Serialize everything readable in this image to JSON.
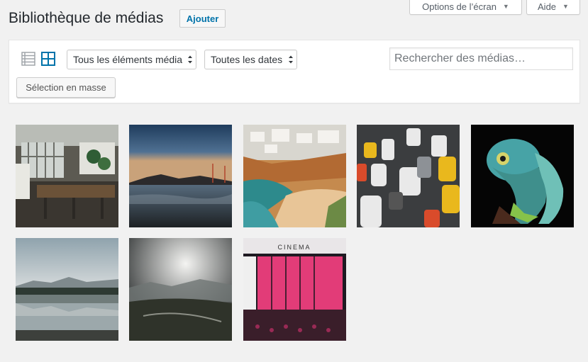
{
  "screen_meta": {
    "options_label": "Options de l’écran",
    "help_label": "Aide"
  },
  "header": {
    "title": "Bibliothèque de médias",
    "add_new_label": "Ajouter"
  },
  "toolbar": {
    "view_modes": [
      "list-view-icon",
      "grid-view-icon"
    ],
    "active_view": "grid",
    "type_filter_value": "Tous les éléments média",
    "date_filter_value": "Toutes les dates",
    "search_placeholder": "Rechercher des médias…",
    "bulk_select_label": "Sélection en masse"
  },
  "media_items": [
    {
      "subject": "workshop-interior"
    },
    {
      "subject": "bay-bridge-dusk"
    },
    {
      "subject": "coastal-cliffs-village"
    },
    {
      "subject": "traffic-jam-aerial"
    },
    {
      "subject": "green-lizard"
    },
    {
      "subject": "mountain-lake-reflection"
    },
    {
      "subject": "misty-valley"
    },
    {
      "subject": "cinema-storefront"
    }
  ],
  "colors": {
    "accent": "#0073aa",
    "background": "#f1f1f1"
  }
}
